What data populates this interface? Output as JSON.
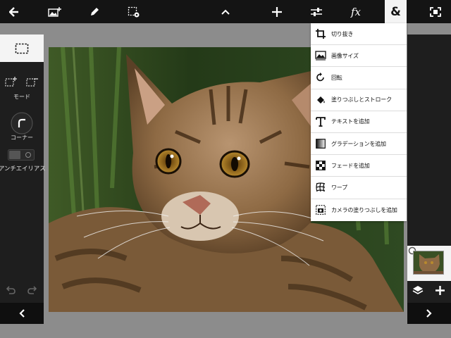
{
  "toolbar": {
    "buttons": [
      {
        "name": "back",
        "icon": "arrow-left-icon"
      },
      {
        "name": "add-image",
        "icon": "image-add-icon"
      },
      {
        "name": "draw",
        "icon": "pencil-icon"
      },
      {
        "name": "selection-settings",
        "icon": "selection-gear-icon"
      },
      {
        "name": "collapse",
        "icon": "chevron-up-icon"
      },
      {
        "name": "add",
        "icon": "plus-icon"
      },
      {
        "name": "adjustments",
        "icon": "sliders-icon"
      },
      {
        "name": "effects",
        "icon": "fx-icon"
      },
      {
        "name": "more-tools",
        "icon": "ampersand-icon",
        "active": true
      },
      {
        "name": "fit-screen",
        "icon": "fit-screen-icon"
      }
    ],
    "fx_label": "fx",
    "ampersand_label": "&"
  },
  "left_panel": {
    "mode_label": "モード",
    "corner_label": "コーナー",
    "antialias_label": "アンチエイリアス"
  },
  "menu": {
    "items": [
      {
        "label": "切り抜き",
        "icon": "crop-icon"
      },
      {
        "label": "画像サイズ",
        "icon": "image-size-icon"
      },
      {
        "label": "回転",
        "icon": "rotate-icon"
      },
      {
        "label": "塗りつぶしとストローク",
        "icon": "fill-bucket-icon"
      },
      {
        "label": "テキストを追加",
        "icon": "text-icon"
      },
      {
        "label": "グラデーションを追加",
        "icon": "gradient-icon"
      },
      {
        "label": "フェードを追加",
        "icon": "fade-icon"
      },
      {
        "label": "ワープ",
        "icon": "warp-icon"
      },
      {
        "label": "カメラの塗りつぶしを追加",
        "icon": "camera-fill-icon"
      }
    ]
  },
  "colors": {
    "toolbar_bg": "#141414",
    "panel_bg": "#1e1e1e",
    "workspace_bg": "#8c8c8c",
    "active_tab": "#f4f4f4"
  }
}
